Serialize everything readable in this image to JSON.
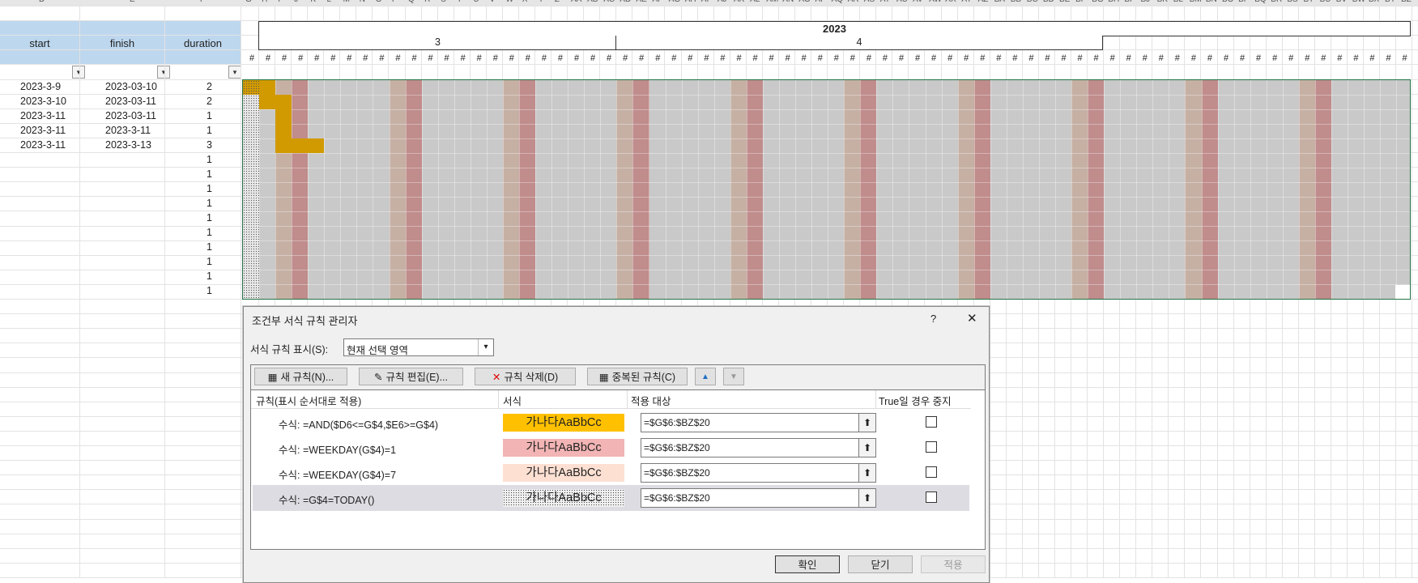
{
  "column_letters": [
    "D",
    "E",
    "F",
    "G",
    "H",
    "I",
    "J",
    "K",
    "L",
    "M",
    "N",
    "O",
    "P",
    "Q",
    "R",
    "S",
    "T",
    "U",
    "V",
    "W",
    "X",
    "Y",
    "Z",
    "AA",
    "AB",
    "AC",
    "AD",
    "AE",
    "AF",
    "AG",
    "AH",
    "AI",
    "AJ",
    "AK",
    "AL",
    "AM",
    "AN",
    "AO",
    "AP",
    "AQ",
    "AR",
    "AS",
    "AT",
    "AU",
    "AV",
    "AW",
    "AX",
    "AY",
    "AZ",
    "BA",
    "BB",
    "BC",
    "BD",
    "BE",
    "BF",
    "BG",
    "BH",
    "BI",
    "BJ",
    "BK",
    "BL",
    "BM",
    "BN",
    "BO",
    "BP",
    "BQ",
    "BR",
    "BS",
    "BT",
    "BU",
    "BV",
    "BW",
    "BX",
    "BY",
    "BZ"
  ],
  "sheet": {
    "headers": {
      "start": "start",
      "finish": "finish",
      "duration": "duration"
    },
    "filter_glyph": "▾",
    "rows": [
      {
        "start": "2023-3-9",
        "finish": "2023-03-10",
        "duration": "2"
      },
      {
        "start": "2023-3-10",
        "finish": "2023-03-11",
        "duration": "2"
      },
      {
        "start": "2023-3-11",
        "finish": "2023-03-11",
        "duration": "1"
      },
      {
        "start": "2023-3-11",
        "finish": "2023-3-11",
        "duration": "1"
      },
      {
        "start": "2023-3-11",
        "finish": "2023-3-13",
        "duration": "3"
      },
      {
        "start": "",
        "finish": "",
        "duration": "1"
      },
      {
        "start": "",
        "finish": "",
        "duration": "1"
      },
      {
        "start": "",
        "finish": "",
        "duration": "1"
      },
      {
        "start": "",
        "finish": "",
        "duration": "1"
      },
      {
        "start": "",
        "finish": "",
        "duration": "1"
      },
      {
        "start": "",
        "finish": "",
        "duration": "1"
      },
      {
        "start": "",
        "finish": "",
        "duration": "1"
      },
      {
        "start": "",
        "finish": "",
        "duration": "1"
      },
      {
        "start": "",
        "finish": "",
        "duration": "1"
      },
      {
        "start": "",
        "finish": "",
        "duration": "1"
      }
    ],
    "gantt": {
      "year": "2023",
      "months": [
        "3",
        "4"
      ],
      "hash_glyph": "#",
      "colors": {
        "weekday": "#c9c9c9",
        "saturday": "#c6b0a4",
        "sunday": "#c08c8c",
        "bar": "#d19a00",
        "today": "#e6e6e6"
      }
    }
  },
  "dialog": {
    "title": "조건부 서식 규칙 관리자",
    "help": "?",
    "close": "✕",
    "show_rules_label": "서식 규칙 표시(S):",
    "show_rules_value": "현재 선택 영역",
    "toolbar": {
      "new_rule": "새 규칙(N)...",
      "edit_rule": "규칙 편집(E)...",
      "delete_rule": "규칙 삭제(D)",
      "duplicate_rule": "중복된 규칙(C)",
      "move_up": "▲",
      "move_down": "▼"
    },
    "columns": {
      "rule": "규칙(표시 순서대로 적용)",
      "format": "서식",
      "applies_to": "적용 대상",
      "stop_if_true": "True일 경우 중지"
    },
    "rules": [
      {
        "rule": "수식: =AND($D6<=G$4,$E6>=G$4)",
        "preview": "가나다AaBbCc",
        "applies_to": "=$G$6:$BZ$20",
        "bg": "#ffc000"
      },
      {
        "rule": "수식: =WEEKDAY(G$4)=1",
        "preview": "가나다AaBbCc",
        "applies_to": "=$G$6:$BZ$20",
        "bg": "#f2b4b4"
      },
      {
        "rule": "수식: =WEEKDAY(G$4)=7",
        "preview": "가나다AaBbCc",
        "applies_to": "=$G$6:$BZ$20",
        "bg": "#fde0d2"
      },
      {
        "rule": "수식: =G$4=TODAY()",
        "preview": "가나다AaBbCc",
        "applies_to": "=$G$6:$BZ$20",
        "bg": "#f0f0f0"
      }
    ],
    "ref_button": "⬆",
    "ok": "확인",
    "close_btn": "닫기",
    "apply": "적용"
  }
}
